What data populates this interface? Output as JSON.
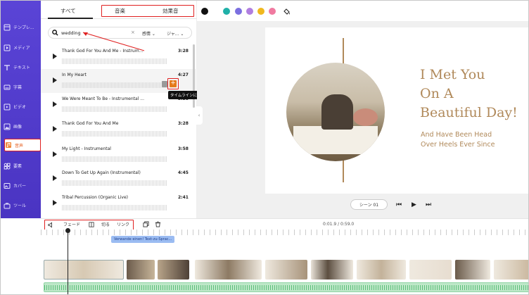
{
  "sidebar": {
    "items": [
      {
        "label": "テンプレ..."
      },
      {
        "label": "メディア"
      },
      {
        "label": "テキスト"
      },
      {
        "label": "字幕"
      },
      {
        "label": "ビデオ"
      },
      {
        "label": "画像"
      },
      {
        "label": "音声",
        "active": true
      },
      {
        "label": "要素"
      },
      {
        "label": "カバー"
      },
      {
        "label": "ツール"
      }
    ]
  },
  "panel": {
    "tabs": {
      "all": "すべて",
      "music": "音楽",
      "sfx": "効果音"
    },
    "search": {
      "query": "wedding",
      "clear": "×",
      "filter_mood": "感情 ⌄",
      "filter_genre": "ジャ... ⌄"
    },
    "tracks": [
      {
        "name": "Thank God For You And Me - Instrum...",
        "duration": "3:28"
      },
      {
        "name": "In My Heart",
        "duration": "4:27"
      },
      {
        "name": "We Were Meant To Be - Instrumental ...",
        "duration": "3:38"
      },
      {
        "name": "Thank God For You And Me",
        "duration": "3:28"
      },
      {
        "name": "My Light - Instrumental",
        "duration": "3:58"
      },
      {
        "name": "Down To Get Up Again (Instrumental)",
        "duration": "4:45"
      },
      {
        "name": "Tribal Percussion (Organic Live)",
        "duration": "2:41"
      }
    ],
    "tooltip": "タイムラインに"
  },
  "colors": {
    "swatches": [
      "#111111",
      "#1fb0a8",
      "#7b6fe0",
      "#b07ee0",
      "#f0b81e",
      "#f07aa0"
    ]
  },
  "slide": {
    "line1": "I Met You",
    "line2": "On A",
    "line3": "Beautiful Day!",
    "sub1": "And Have Been Head",
    "sub2": "Over Heels Ever Since"
  },
  "playback": {
    "scene": "シーン 01",
    "prev": "⏮",
    "play": "▶",
    "next": "⏭"
  },
  "timeline_toolbar": {
    "fade": "フェード",
    "split": "切る",
    "link": "リンク",
    "time": "0:01.9 / 0:59.0"
  },
  "timeline": {
    "caption": "Verwande einen! Text-zu-Sprac..."
  }
}
